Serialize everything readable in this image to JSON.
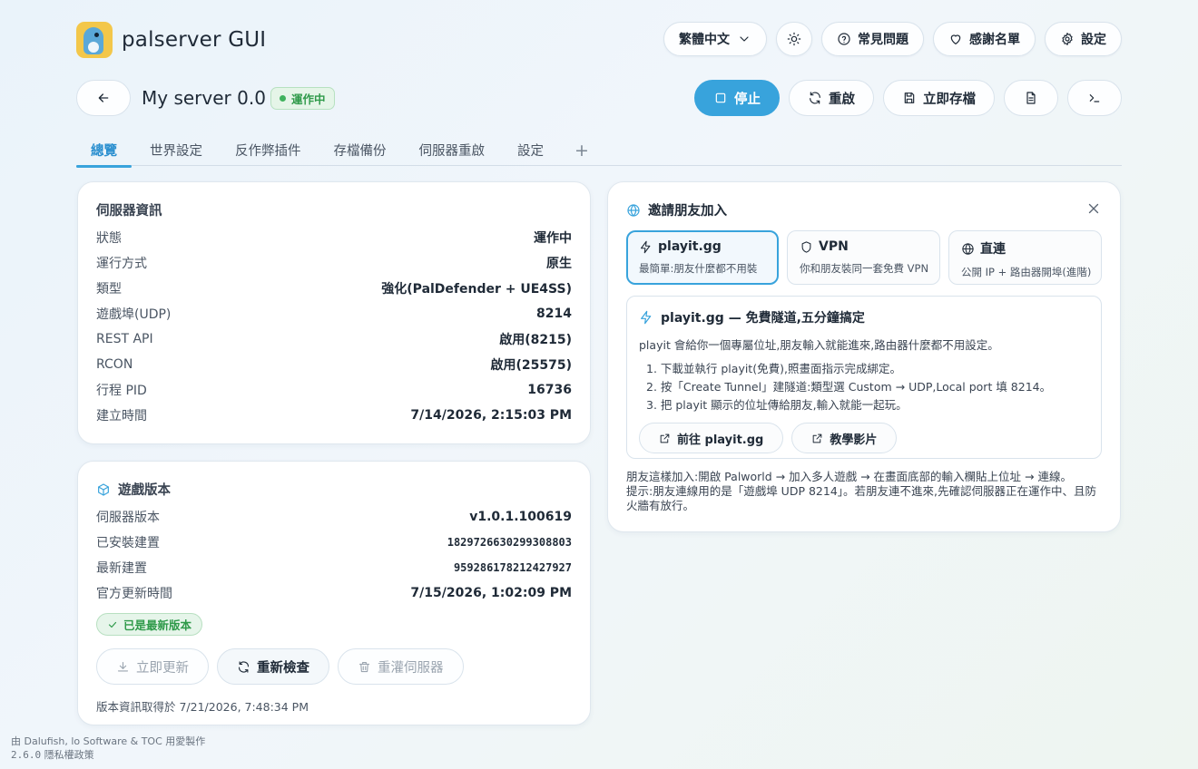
{
  "app": {
    "title": "palserver GUI"
  },
  "header": {
    "language": "繁體中文",
    "faq_label": "常見問題",
    "credits_label": "感謝名單",
    "settings_label": "設定"
  },
  "server": {
    "name": "My server 0.0",
    "status": "運作中",
    "actions": {
      "stop": "停止",
      "restart": "重啟",
      "save": "立即存檔"
    }
  },
  "tabs": [
    {
      "label": "總覽"
    },
    {
      "label": "世界設定"
    },
    {
      "label": "反作弊插件"
    },
    {
      "label": "存檔備份"
    },
    {
      "label": "伺服器重啟"
    },
    {
      "label": "設定"
    },
    {
      "label": "+"
    }
  ],
  "server_info": {
    "title": "伺服器資訊",
    "rows": [
      {
        "key": "狀態",
        "value": "運作中"
      },
      {
        "key": "運行方式",
        "value": "原生"
      },
      {
        "key": "類型",
        "value": "強化(PalDefender + UE4SS)"
      },
      {
        "key": "遊戲埠(UDP)",
        "value": "8214"
      },
      {
        "key": "REST API",
        "value": "啟用(8215)"
      },
      {
        "key": "RCON",
        "value": "啟用(25575)"
      },
      {
        "key": "行程 PID",
        "value": "16736"
      },
      {
        "key": "建立時間",
        "value": "7/14/2026, 2:15:03 PM"
      }
    ]
  },
  "game_version": {
    "title": "遊戲版本",
    "rows": [
      {
        "key": "伺服器版本",
        "value": "v1.0.1.100619"
      },
      {
        "key": "已安裝建置",
        "value": "1829726630299308803"
      },
      {
        "key": "最新建置",
        "value": "959286178212427927"
      },
      {
        "key": "官方更新時間",
        "value": "7/15/2026, 1:02:09 PM"
      }
    ],
    "latest_badge": "已是最新版本",
    "buttons": {
      "update": "立即更新",
      "recheck": "重新檢查",
      "reinstall": "重灌伺服器"
    },
    "note": "版本資訊取得於 7/21/2026, 7:48:34 PM"
  },
  "invite": {
    "title": "邀請朋友加入",
    "methods": [
      {
        "name": "playit.gg",
        "desc": "最簡單:朋友什麼都不用裝"
      },
      {
        "name": "VPN",
        "desc": "你和朋友裝同一套免費 VPN"
      },
      {
        "name": "直連",
        "desc": "公開 IP + 路由器開埠(進階)"
      }
    ],
    "guide": {
      "title": "playit.gg — 免費隧道,五分鐘搞定",
      "intro": "playit 會給你一個專屬位址,朋友輸入就能進來,路由器什麼都不用設定。",
      "steps": [
        "1. 下載並執行 playit(免費),照畫面指示完成綁定。",
        "2. 按「Create Tunnel」建隧道:類型選 Custom → UDP,Local port 填 8214。",
        "3. 把 playit 顯示的位址傳給朋友,輸入就能一起玩。"
      ],
      "link_site": "前往 playit.gg",
      "link_video": "教學影片"
    },
    "footer_1": "朋友這樣加入:開啟 Palworld → 加入多人遊戲 → 在畫面底部的輸入欄貼上位址 → 連線。",
    "footer_2": "提示:朋友連線用的是「遊戲埠 UDP 8214」。若朋友連不進來,先確認伺服器正在運作中、且防火牆有放行。"
  },
  "footer": {
    "credit": "由 Dalufish, lo Software & TOC 用愛製作",
    "version": "2.6.0",
    "privacy": "隱私權政策"
  },
  "colors": {
    "accent": "#38a3dc",
    "success": "#2f9a4a",
    "success_bg": "#e5f5e8"
  }
}
